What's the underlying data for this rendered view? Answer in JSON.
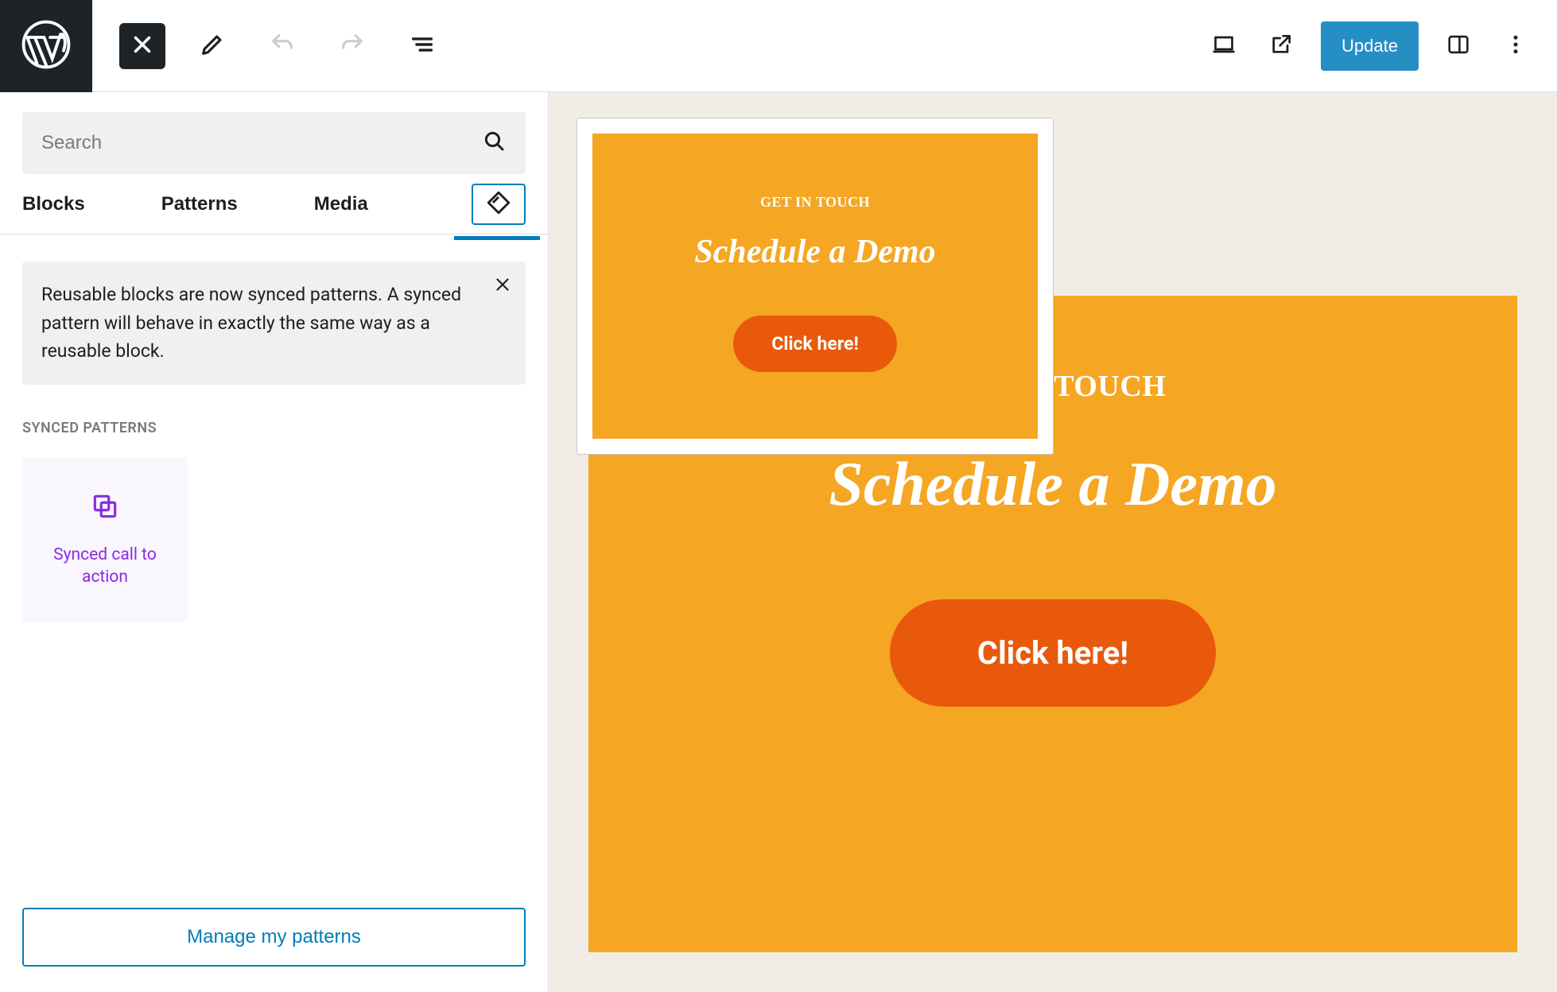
{
  "topbar": {
    "update_label": "Update"
  },
  "sidebar": {
    "search_placeholder": "Search",
    "tabs": {
      "blocks": "Blocks",
      "patterns": "Patterns",
      "media": "Media"
    },
    "notice": "Reusable blocks are now synced patterns. A synced pattern will behave in exactly the same way as a reusable block.",
    "section_label": "SYNCED PATTERNS",
    "pattern_tile_label": "Synced call to action",
    "manage_label": "Manage my patterns"
  },
  "cta": {
    "eyebrow": "GET IN TOUCH",
    "heading": "Schedule a Demo",
    "button": "Click here!"
  },
  "colors": {
    "accent_blue": "#007cba",
    "cta_bg": "#f5a623",
    "cta_button": "#e8590c",
    "synced_purple": "#8a2be2"
  }
}
